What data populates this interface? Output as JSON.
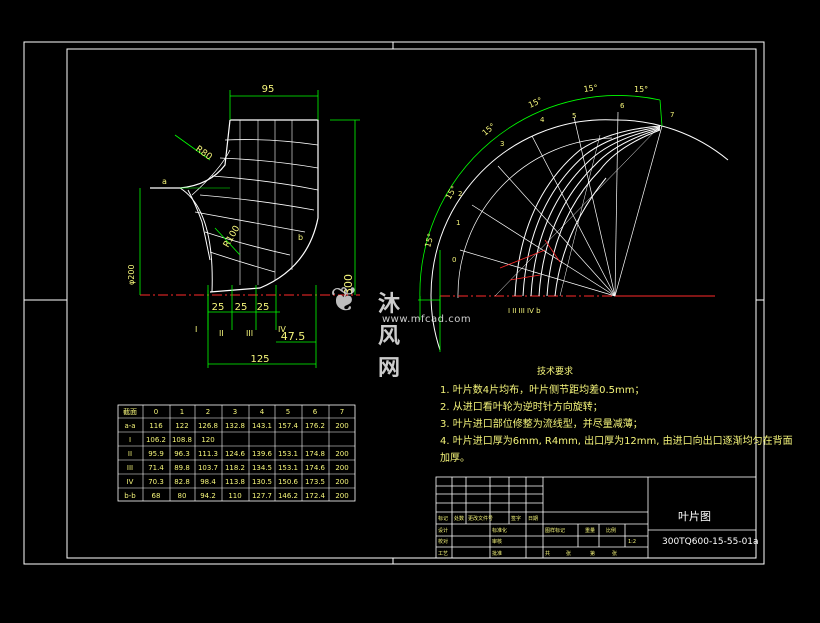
{
  "drawing": {
    "dimensions": {
      "top_width": "95",
      "radius_r80": "R80",
      "radius_r100": "R100",
      "height_left": "φ200",
      "height_right": "300",
      "seg_1": "25",
      "seg_2": "25",
      "seg_3": "25",
      "bottom_gap": "47.5",
      "bottom_width": "125",
      "mark_a": "a",
      "mark_b": "b",
      "sec_1": "I",
      "sec_2": "II",
      "sec_3": "III",
      "sec_4": "IV"
    },
    "angles": [
      "15°",
      "15°",
      "15°",
      "15°",
      "15°"
    ],
    "stations": [
      "0",
      "1",
      "2",
      "3",
      "4",
      "5",
      "6",
      "7"
    ],
    "bottom_marks": "I  II  III IV b"
  },
  "requirements": {
    "title": "技术要求",
    "items": [
      "1. 叶片数4片均布，叶片侧节距均差0.5mm；",
      "2. 从进口看叶轮为逆时针方向旋转；",
      "3. 叶片进口部位修整为流线型，并尽量减薄；",
      "4. 叶片进口厚为6mm, R4mm, 出口厚为12mm, 由进口向出口逐渐均匀在背面",
      "加厚。"
    ]
  },
  "data_table": {
    "header": [
      "截面",
      "0",
      "1",
      "2",
      "3",
      "4",
      "5",
      "6",
      "7"
    ],
    "rows": [
      [
        "a-a",
        "116",
        "122",
        "126.8",
        "132.8",
        "143.1",
        "157.4",
        "176.2",
        "200"
      ],
      [
        "I",
        "106.2",
        "108.8",
        "120",
        "",
        "",
        "",
        "",
        ""
      ],
      [
        "II",
        "95.9",
        "96.3",
        "111.3",
        "124.6",
        "139.6",
        "153.1",
        "174.8",
        "200"
      ],
      [
        "III",
        "71.4",
        "89.8",
        "103.7",
        "118.2",
        "134.5",
        "153.1",
        "174.6",
        "200"
      ],
      [
        "IV",
        "70.3",
        "82.8",
        "98.4",
        "113.8",
        "130.5",
        "150.6",
        "173.5",
        "200"
      ],
      [
        "b-b",
        "68",
        "80",
        "94.2",
        "110",
        "127.7",
        "146.2",
        "172.4",
        "200"
      ]
    ]
  },
  "title_block": {
    "drawing_name": "叶片图",
    "drawing_code": "300TQ600-15-55-01a",
    "cell_labels": [
      "标记",
      "处数",
      "更改文件号",
      "签字",
      "日期",
      "设计",
      "标准化",
      "校对",
      "审核",
      "工艺",
      "批准",
      "图样标记",
      "重量",
      "比例",
      "共",
      "张",
      "第",
      "张"
    ],
    "scale": "1:2"
  },
  "watermark": {
    "logo_glyph": "❦",
    "name": "沐风网",
    "url": "www.mfcad.com"
  },
  "colors": {
    "background": "#000000",
    "line": "#ffffff",
    "dimension": "#00ff00",
    "text": "#f5f57a",
    "axis": "#ff2a2a",
    "table_text": "#f5f57a"
  }
}
